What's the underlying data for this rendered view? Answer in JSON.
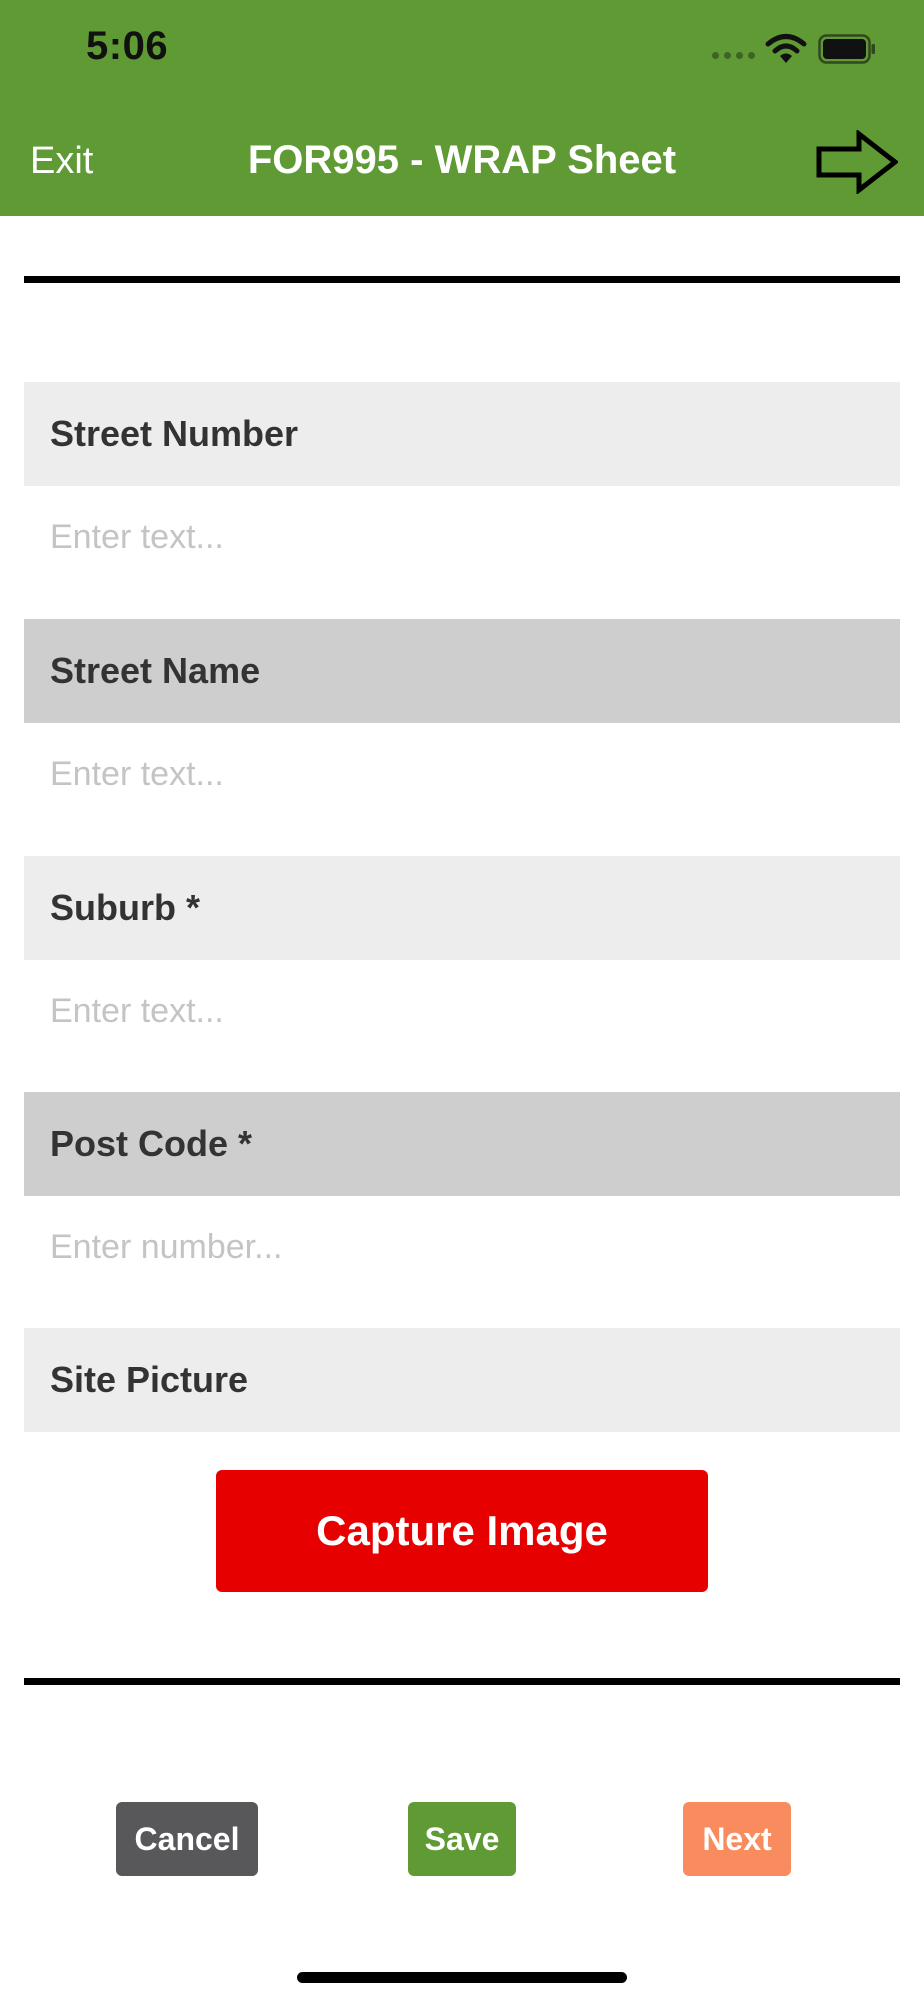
{
  "status_bar": {
    "time": "5:06",
    "icons": [
      "signal-dots-icon",
      "wifi-icon",
      "battery-icon"
    ]
  },
  "header": {
    "exit_label": "Exit",
    "title": "FOR995 - WRAP Sheet",
    "next_icon": "arrow-right-icon",
    "background": "#5f9a35"
  },
  "form": {
    "fields": [
      {
        "label": "Street Number",
        "placeholder": "Enter text...",
        "value": ""
      },
      {
        "label": "Street Name",
        "placeholder": "Enter text...",
        "value": ""
      },
      {
        "label": "Suburb *",
        "placeholder": "Enter text...",
        "value": ""
      },
      {
        "label": "Post Code *",
        "placeholder": "Enter number...",
        "value": ""
      }
    ],
    "site_picture": {
      "label": "Site Picture",
      "capture_label": "Capture Image"
    }
  },
  "actions": {
    "cancel_label": "Cancel",
    "save_label": "Save",
    "next_label": "Next"
  },
  "colors": {
    "brand_green": "#5f9a35",
    "capture_red": "#e60000",
    "cancel_gray": "#58585a",
    "next_orange": "#f98c5f",
    "label_light": "#ededed",
    "label_dark": "#cecece"
  }
}
